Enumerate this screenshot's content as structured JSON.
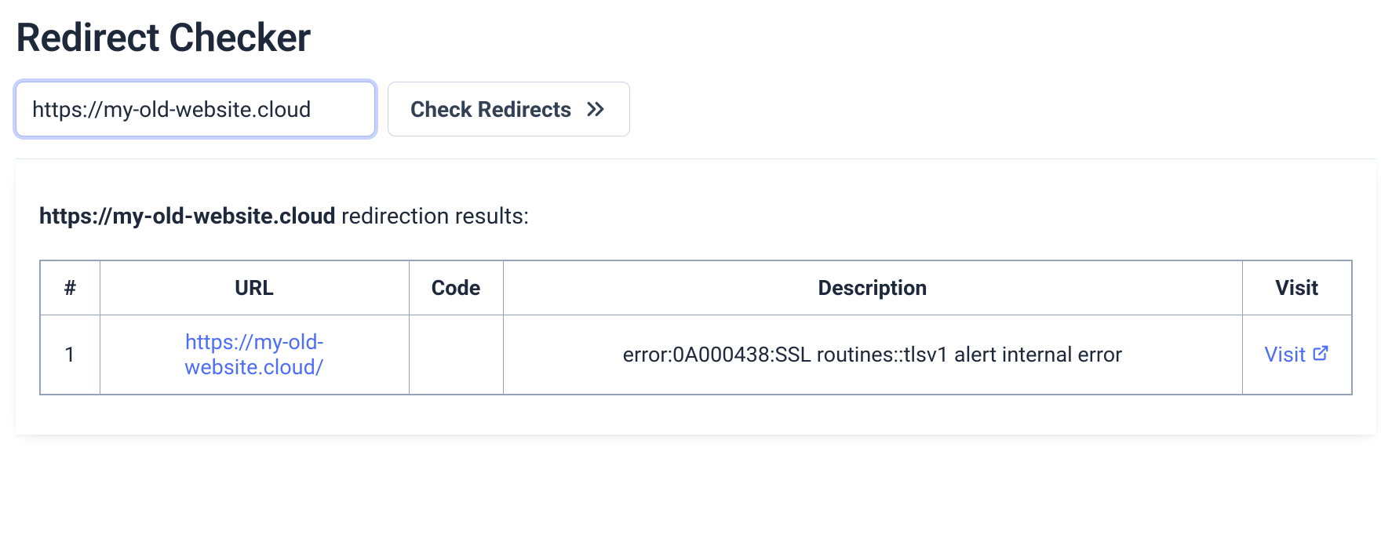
{
  "page": {
    "title": "Redirect Checker"
  },
  "form": {
    "url_value": "https://my-old-website.cloud",
    "check_button_label": "Check Redirects"
  },
  "results": {
    "heading_url": "https://my-old-website.cloud",
    "heading_suffix": " redirection results:",
    "columns": {
      "num": "#",
      "url": "URL",
      "code": "Code",
      "description": "Description",
      "visit": "Visit"
    },
    "rows": [
      {
        "num": "1",
        "url": "https://my-old-website.cloud/",
        "code": "",
        "description": "error:0A000438:SSL routines::tlsv1 alert internal error",
        "visit_label": "Visit"
      }
    ]
  }
}
